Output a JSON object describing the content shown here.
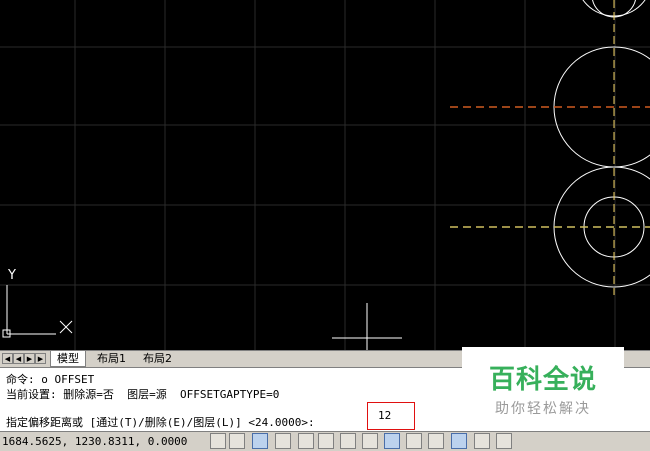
{
  "axis": {
    "y_label": "Y"
  },
  "tabs": [
    {
      "label": "模型",
      "active": true
    },
    {
      "label": "布局1",
      "active": false
    },
    {
      "label": "布局2",
      "active": false
    }
  ],
  "nav_buttons": [
    "first-icon",
    "prev-icon",
    "next-icon",
    "last-icon"
  ],
  "command": {
    "line1": "命令: o OFFSET",
    "line2": "当前设置: 删除源=否  图层=源  OFFSETGAPTYPE=0",
    "prompt": "指定偏移距离或 [通过(T)/删除(E)/图层(L)] <24.0000>:",
    "input_value": "12"
  },
  "watermark": {
    "title": "百科全说",
    "subtitle": "助你轻松解决"
  },
  "status": {
    "coordinates": "1684.5625, 1230.8311, 0.0000",
    "buttons": [
      "snap-icon",
      "grid-display-icon",
      "grid-icon",
      "ortho-icon",
      "polar-icon",
      "osnap-icon",
      "otrack-icon",
      "ducs-icon",
      "dyn-icon",
      "lineweight-icon",
      "qp-icon",
      "sc-icon",
      "am-icon",
      "tpy-icon"
    ]
  },
  "colors": {
    "orange_dashed": "#d05a20",
    "yellow_dashed": "#d0c060",
    "highlight_red": "#e01010",
    "brand_green": "#37b05b"
  }
}
